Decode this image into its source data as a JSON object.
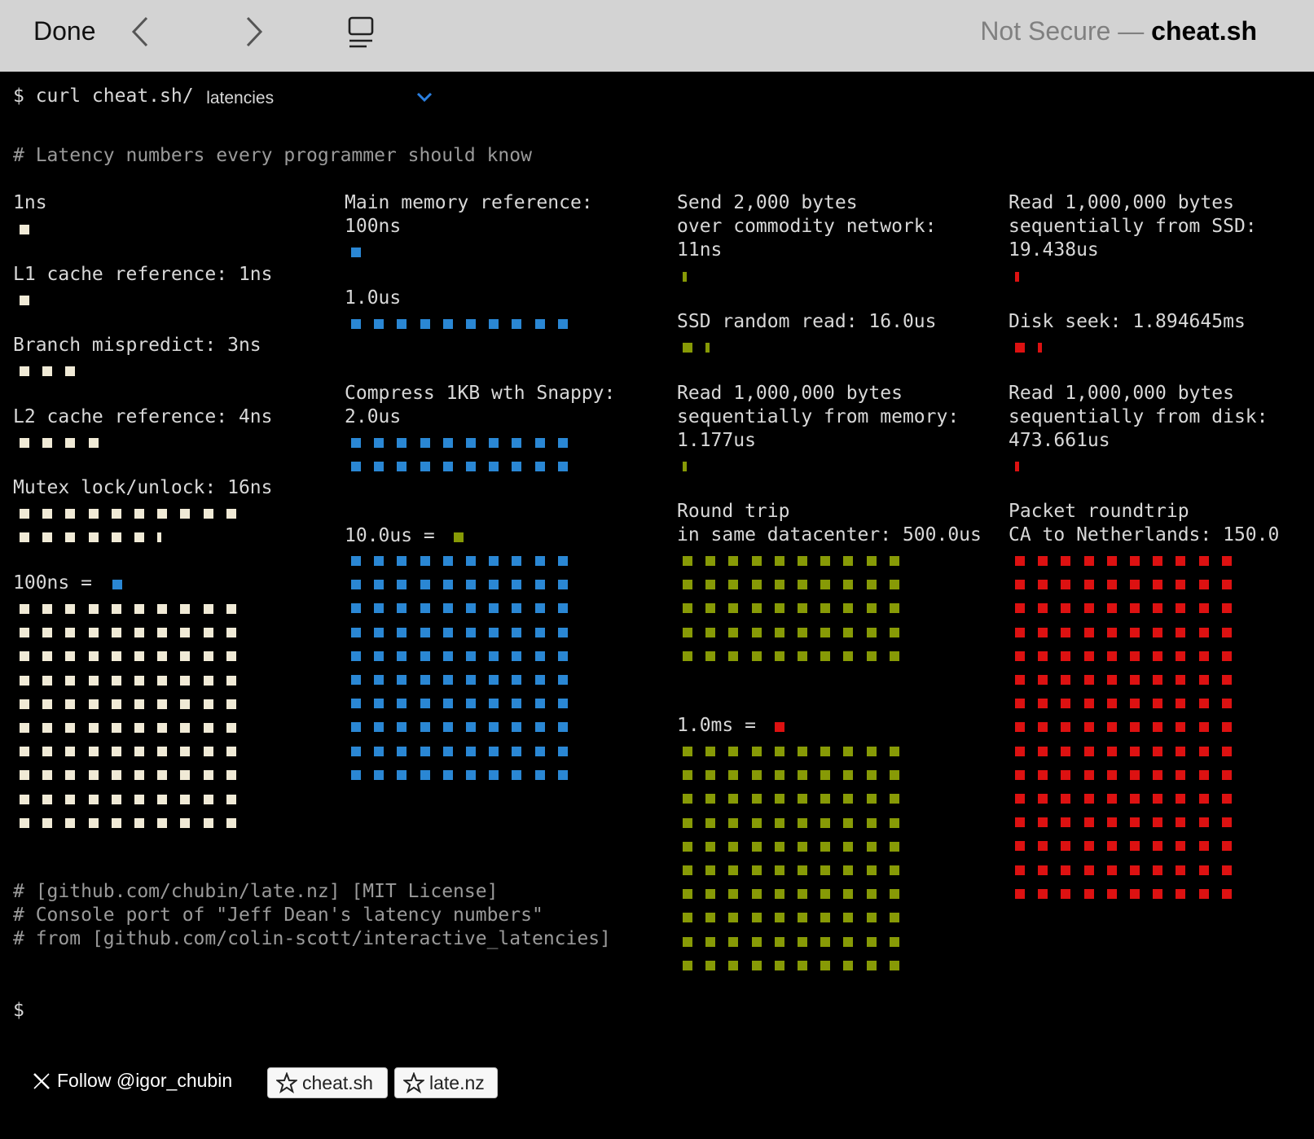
{
  "browser": {
    "done_label": "Done",
    "security": "Not Secure —",
    "host": "cheat.sh"
  },
  "terminal": {
    "prompt_cmd": "$ curl cheat.sh/",
    "topic_value": "latencies",
    "header_comment": "# Latency numbers every programmer should know",
    "end_prompt": "$",
    "footer_comments": [
      "# [github.com/chubin/late.nz] [MIT License]",
      "# Console port of \"Jeff Dean's latency numbers\"",
      "# from [github.com/colin-scott/interactive_latencies]"
    ]
  },
  "colors": {
    "ns": "#f0ead6",
    "us": "#2a87d4",
    "net": "#879a06",
    "disk": "#dd1111"
  },
  "col1": {
    "l_1ns": "1ns",
    "l_l1": "L1 cache reference: 1ns",
    "l_branch": "Branch mispredict: 3ns",
    "l_l2": "L2 cache reference: 4ns",
    "l_mutex": "Mutex lock/unlock: 16ns",
    "l_100ns": "100ns ="
  },
  "col2": {
    "l_main_mem_1": "Main memory reference:",
    "l_main_mem_2": "100ns",
    "l_1us": "1.0us",
    "l_compress_1": "Compress 1KB wth Snappy:",
    "l_compress_2": "2.0us",
    "l_10us": "10.0us ="
  },
  "col3": {
    "l_send_1": "Send 2,000 bytes",
    "l_send_2": "over commodity network:",
    "l_send_3": "11ns",
    "l_ssd": "SSD random read: 16.0us",
    "l_readmem_1": "Read 1,000,000 bytes",
    "l_readmem_2": "sequentially from memory:",
    "l_readmem_3": "1.177us",
    "l_rt_1": "Round trip",
    "l_rt_2": "in same datacenter: 500.0us",
    "l_1ms": "1.0ms ="
  },
  "col4": {
    "l_ssdseq_1": "Read 1,000,000 bytes",
    "l_ssdseq_2": "sequentially from SSD:",
    "l_ssdseq_3": "19.438us",
    "l_seek": "Disk seek: 1.894645ms",
    "l_diskseq_1": "Read 1,000,000 bytes",
    "l_diskseq_2": "sequentially from disk:",
    "l_diskseq_3": "473.661us",
    "l_packet_1": "Packet roundtrip",
    "l_packet_2": "CA to Netherlands: 150.0"
  },
  "footer": {
    "follow": "Follow @igor_chubin",
    "star1": "cheat.sh",
    "star2": "late.nz"
  }
}
